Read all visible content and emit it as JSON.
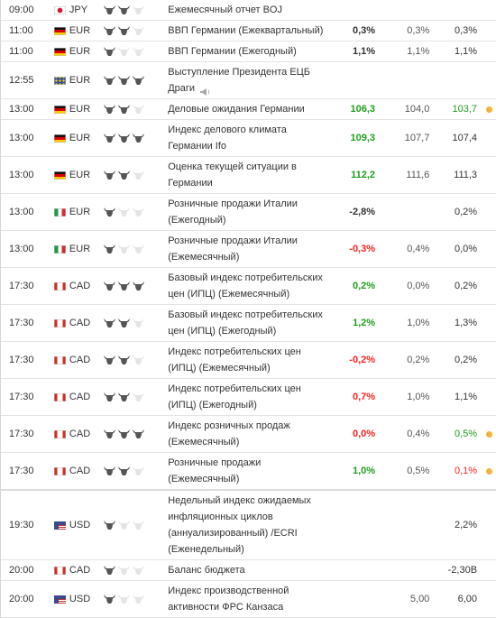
{
  "colors": {
    "green": "#1e9e1e",
    "red": "#ff2020",
    "neutral": "#333333",
    "purple": "#553377",
    "dot": "#f0b43c",
    "bull_on": "#555555",
    "bull_off": "#e4e4e4"
  },
  "events": [
    {
      "time": "09:00",
      "flag": "jp",
      "currency": "JPY",
      "importance": 2,
      "event": "Ежемесячный отчет BOJ",
      "actual": "",
      "actual_color": "neutral",
      "forecast": "",
      "previous": "",
      "previous_color": "neutral",
      "revised": false
    },
    {
      "time": "11:00",
      "flag": "de",
      "currency": "EUR",
      "importance": 2,
      "event": "ВВП Германии (Ежеквартальный)",
      "actual": "0,3%",
      "actual_color": "neutral",
      "forecast": "0,3%",
      "previous": "0,3%",
      "previous_color": "neutral",
      "revised": false
    },
    {
      "time": "11:00",
      "flag": "de",
      "currency": "EUR",
      "importance": 1,
      "event": "ВВП Германии (Ежегодный)",
      "actual": "1,1%",
      "actual_color": "neutral",
      "forecast": "1,1%",
      "previous": "1,1%",
      "previous_color": "neutral",
      "revised": false
    },
    {
      "time": "12:55",
      "flag": "eu",
      "currency": "EUR",
      "importance": 3,
      "event": "Выступление Президента ЕЦБ Драги",
      "speech": true,
      "actual": "",
      "actual_color": "neutral",
      "forecast": "",
      "previous": "",
      "previous_color": "neutral",
      "revised": false
    },
    {
      "time": "13:00",
      "flag": "de",
      "currency": "EUR",
      "importance": 2,
      "event": "Деловые ожидания Германии",
      "actual": "106,3",
      "actual_color": "green",
      "forecast": "104,0",
      "previous": "103,7",
      "previous_color": "green",
      "revised": true
    },
    {
      "time": "13:00",
      "flag": "de",
      "currency": "EUR",
      "importance": 3,
      "event": "Индекс делового климата Германии Ifo",
      "actual": "109,3",
      "actual_color": "green",
      "forecast": "107,7",
      "previous": "107,4",
      "previous_color": "neutral",
      "revised": false
    },
    {
      "time": "13:00",
      "flag": "de",
      "currency": "EUR",
      "importance": 2,
      "event": "Оценка текущей ситуации в Германии",
      "actual": "112,2",
      "actual_color": "green",
      "forecast": "111,6",
      "previous": "111,3",
      "previous_color": "neutral",
      "revised": false
    },
    {
      "time": "13:00",
      "flag": "it",
      "currency": "EUR",
      "importance": 1,
      "event": "Розничные продажи Италии (Ежегодный)",
      "actual": "-2,8%",
      "actual_color": "neutral",
      "forecast": "",
      "previous": "0,2%",
      "previous_color": "neutral",
      "revised": false
    },
    {
      "time": "13:00",
      "flag": "it",
      "currency": "EUR",
      "importance": 1,
      "event": "Розничные продажи Италии (Ежемесячный)",
      "actual": "-0,3%",
      "actual_color": "red",
      "forecast": "0,4%",
      "previous": "0,0%",
      "previous_color": "neutral",
      "revised": false
    },
    {
      "time": "17:30",
      "flag": "ca",
      "currency": "CAD",
      "importance": 3,
      "event": "Базовый индекс потребительских цен (ИПЦ) (Ежемесячный)",
      "actual": "0,2%",
      "actual_color": "green",
      "forecast": "0,0%",
      "previous": "0,2%",
      "previous_color": "neutral",
      "revised": false
    },
    {
      "time": "17:30",
      "flag": "ca",
      "currency": "CAD",
      "importance": 2,
      "event": "Базовый индекс потребительских цен (ИПЦ) (Ежегодный)",
      "actual": "1,2%",
      "actual_color": "green",
      "forecast": "1,0%",
      "previous": "1,3%",
      "previous_color": "neutral",
      "revised": false
    },
    {
      "time": "17:30",
      "flag": "ca",
      "currency": "CAD",
      "importance": 2,
      "event": "Индекс потребительских цен (ИПЦ) (Ежемесячный)",
      "actual": "-0,2%",
      "actual_color": "red",
      "forecast": "0,2%",
      "previous": "0,2%",
      "previous_color": "neutral",
      "revised": false
    },
    {
      "time": "17:30",
      "flag": "ca",
      "currency": "CAD",
      "importance": 2,
      "event": "Индекс потребительских цен (ИПЦ) (Ежегодный)",
      "actual": "0,7%",
      "actual_color": "red",
      "forecast": "1,0%",
      "previous": "1,1%",
      "previous_color": "neutral",
      "revised": false
    },
    {
      "time": "17:30",
      "flag": "ca",
      "currency": "CAD",
      "importance": 3,
      "event": "Индекс розничных продаж (Ежемесячный)",
      "actual": "0,0%",
      "actual_color": "red",
      "forecast": "0,4%",
      "previous": "0,5%",
      "previous_color": "green",
      "revised": true
    },
    {
      "time": "17:30",
      "flag": "ca",
      "currency": "CAD",
      "importance": 2,
      "event": "Розничные продажи (Ежемесячный)",
      "actual": "1,0%",
      "actual_color": "green",
      "forecast": "0,5%",
      "previous": "0,1%",
      "previous_color": "red",
      "revised": true,
      "thick": true
    },
    {
      "time": "19:30",
      "flag": "us",
      "currency": "USD",
      "importance": 1,
      "event": "Недельный индекс ожидаемых инфляционных циклов (аннуализированный) /ECRI (Еженедельный)",
      "actual": "",
      "actual_color": "neutral",
      "forecast": "",
      "previous": "2,2%",
      "previous_color": "neutral",
      "revised": false
    },
    {
      "time": "20:00",
      "flag": "ca",
      "currency": "CAD",
      "importance": 1,
      "event": "Баланс бюджета",
      "actual": "",
      "actual_color": "neutral",
      "forecast": "",
      "previous": "-2,30B",
      "previous_color": "neutral",
      "revised": false
    },
    {
      "time": "20:00",
      "flag": "us",
      "currency": "USD",
      "importance": 1,
      "event": "Индекс производственной активности ФРС Канзаса",
      "actual": "",
      "actual_color": "neutral",
      "forecast": "5,00",
      "previous": "6,00",
      "previous_color": "neutral",
      "revised": false
    }
  ]
}
